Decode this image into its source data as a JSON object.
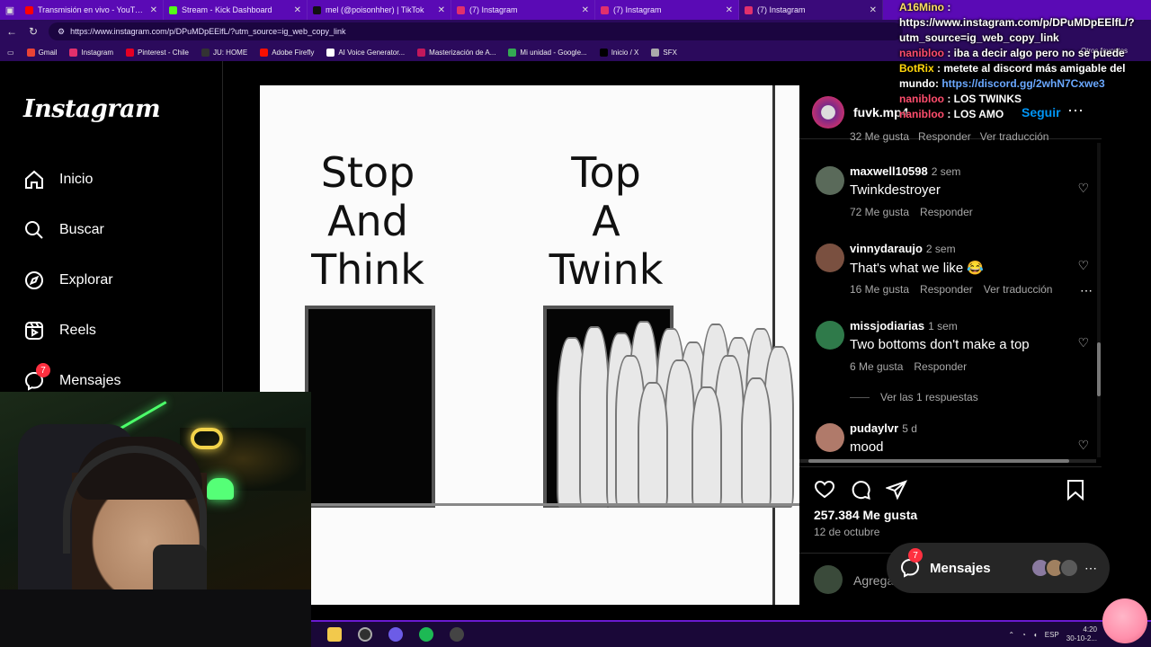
{
  "browser": {
    "tabs": [
      {
        "title": "Transmisión en vivo - YouTube St",
        "color": "#ff0000"
      },
      {
        "title": "Stream - Kick Dashboard",
        "color": "#53fc18"
      },
      {
        "title": "mel (@poisonhher) | TikTok",
        "color": "#111111"
      },
      {
        "title": "(7) Instagram",
        "color": "#e1306c"
      },
      {
        "title": "(7) Instagram",
        "color": "#e1306c"
      },
      {
        "title": "(7) Instagram",
        "color": "#e1306c",
        "active": true
      }
    ],
    "url": "https://www.instagram.com/p/DPuMDpEElfL/?utm_source=ig_web_copy_link",
    "bookmarks": [
      {
        "label": "Gmail",
        "color": "#ea4335"
      },
      {
        "label": "Instagram",
        "color": "#e1306c"
      },
      {
        "label": "Pinterest - Chile",
        "color": "#e60023"
      },
      {
        "label": "JU: HOME",
        "color": "#333333"
      },
      {
        "label": "Adobe Firefly",
        "color": "#fa0f00"
      },
      {
        "label": "AI Voice Generator...",
        "color": "#ffffff"
      },
      {
        "label": "Masterización de A...",
        "color": "#c2185b"
      },
      {
        "label": "Mi unidad - Google...",
        "color": "#34a853"
      },
      {
        "label": "Inicio / X",
        "color": "#000000"
      },
      {
        "label": "SFX",
        "color": "#aaaaaa"
      }
    ],
    "other_favorites": "Otros favoritos"
  },
  "sidebar": {
    "logo": "Instagram",
    "items": [
      {
        "label": "Inicio",
        "icon": "home-icon"
      },
      {
        "label": "Buscar",
        "icon": "search-icon"
      },
      {
        "label": "Explorar",
        "icon": "compass-icon"
      },
      {
        "label": "Reels",
        "icon": "reels-icon"
      },
      {
        "label": "Mensajes",
        "icon": "messenger-icon",
        "badge": "7"
      }
    ]
  },
  "post": {
    "meme": {
      "left": "Stop\nAnd\nThink",
      "right": "Top\nA\nTwink"
    },
    "author": "fuvk.mp4",
    "follow": "Seguir",
    "partial_meta": "32 Me gusta   Responder   Ver traducción",
    "comments": [
      {
        "user": "maxwell10598",
        "time": "2 sem",
        "text": "Twinkdestroyer",
        "likes": "72 Me gusta",
        "reply": "Responder",
        "avatar_color": "#5a6a5a"
      },
      {
        "user": "vinnydaraujo",
        "time": "2 sem",
        "text": "That's what we like 😂",
        "likes": "16 Me gusta",
        "reply": "Responder",
        "translate": "Ver traducción",
        "avatar_color": "#7a5040"
      },
      {
        "user": "missjodiarias",
        "time": "1 sem",
        "text": "Two bottoms don't make a top",
        "likes": "6 Me gusta",
        "reply": "Responder",
        "avatar_color": "#2f7a4a",
        "replies": "Ver las 1 respuestas"
      },
      {
        "user": "pudaylvr",
        "time": "5 d",
        "text": "mood",
        "avatar_color": "#b07a6a"
      }
    ],
    "total_likes": "257.384 Me gusta",
    "date": "12 de octubre",
    "add_comment": "Agrega un comentario..."
  },
  "messages_pill": {
    "label": "Mensajes",
    "badge": "7"
  },
  "chat": [
    {
      "user": "A16Mino",
      "user_color": "#ffe066",
      "text": "https://www.instagram.com/p/DPuMDpEElfL/?utm_source=ig_web_copy_link"
    },
    {
      "user": "nanibloo",
      "user_color": "#ff4d6d",
      "text": "iba a decir algo pero no se puede"
    },
    {
      "user": "BotRix",
      "user_color": "#ffd60a",
      "text": "metete al discord más amigable del mundo:",
      "link": "https://discord.gg/2whN7Cxwe3"
    },
    {
      "user": "nanibloo",
      "user_color": "#ff4d6d",
      "text": "LOS TWINKS"
    },
    {
      "user": "nanibloo",
      "user_color": "#ff4d6d",
      "text": "LOS AMO"
    }
  ],
  "taskbar": {
    "lang": "ESP",
    "time": "4:20",
    "date": "30-10-2..."
  }
}
